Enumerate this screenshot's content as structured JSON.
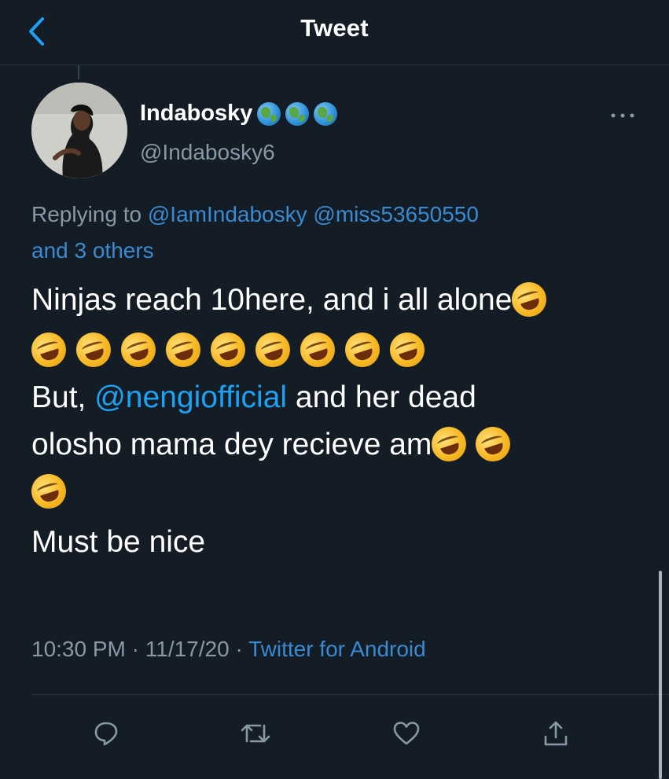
{
  "header": {
    "title": "Tweet"
  },
  "author": {
    "display_name": "Indabosky",
    "handle": "@Indabosky6",
    "name_emojis": [
      "globe-icon",
      "globe-icon",
      "globe-icon"
    ]
  },
  "reply": {
    "prefix": "Replying to",
    "mention_1": "@IamIndabosky",
    "mention_2": "@miss53650550",
    "others": "and 3 others"
  },
  "tweet": {
    "line_1": "Ninjas reach 10here, and i all alone",
    "line_3_prefix": "But,",
    "line_3_mention": "@nengiofficial",
    "line_3_suffix": "and her dead",
    "line_4": "olosho mama dey recieve am",
    "line_6": "Must be nice",
    "emoji_name": "rolling-on-the-floor-laughing-icon"
  },
  "meta": {
    "time": "10:30 PM",
    "separator": "·",
    "date": "11/17/20",
    "source": "Twitter for Android"
  },
  "actions": {
    "reply_icon": "reply-icon",
    "retweet_icon": "retweet-icon",
    "like_icon": "heart-icon",
    "share_icon": "share-icon"
  },
  "colors": {
    "background": "#141d26",
    "link": "#1da1f2",
    "secondary_text": "#8899a6",
    "primary_text": "#ffffff"
  }
}
